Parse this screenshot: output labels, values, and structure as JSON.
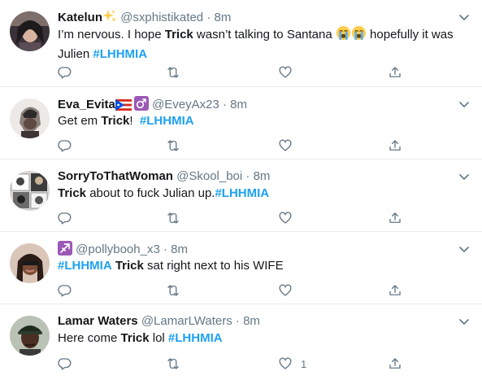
{
  "tweets": [
    {
      "name": "Katelun",
      "handle": "@sxphistikated",
      "separator": "·",
      "time": "8m",
      "name_emoji": "sparkles",
      "segments": [
        {
          "text": "I’m nervous. I hope "
        },
        {
          "text": "Trick",
          "style": "bold"
        },
        {
          "text": " wasn’t talking to Santana "
        },
        {
          "emoji": "crying-face"
        },
        {
          "emoji": "crying-face"
        },
        {
          "text": " hopefully it was Julien "
        },
        {
          "text": "#LHHMIA",
          "style": "hashtag"
        }
      ],
      "reply_count": "",
      "retweet_count": "",
      "like_count": ""
    },
    {
      "name": "Eva_Evita",
      "handle": "@EveyAx23",
      "separator": "·",
      "time": "8m",
      "name_emoji": "flag-puerto-rico-and-male-sign",
      "segments": [
        {
          "text": "Get em "
        },
        {
          "text": "Trick",
          "style": "bold"
        },
        {
          "text": "!  "
        },
        {
          "text": "#LHHMIA",
          "style": "hashtag"
        }
      ],
      "reply_count": "",
      "retweet_count": "",
      "like_count": ""
    },
    {
      "name": "SorryToThatWoman",
      "handle": "@Skool_boi",
      "separator": "·",
      "time": "8m",
      "name_emoji": "",
      "segments": [
        {
          "text": "Trick",
          "style": "bold"
        },
        {
          "text": " about to fuck Julian up."
        },
        {
          "text": "#LHHMIA",
          "style": "hashtag"
        }
      ],
      "reply_count": "",
      "retweet_count": "",
      "like_count": ""
    },
    {
      "name": "",
      "handle": "@pollybooh_x3",
      "separator": "·",
      "time": "8m",
      "name_emoji": "sagittarius",
      "segments": [
        {
          "text": "#LHHMIA",
          "style": "hashtag"
        },
        {
          "text": " "
        },
        {
          "text": "Trick",
          "style": "bold"
        },
        {
          "text": " sat right next to his WIFE"
        }
      ],
      "reply_count": "",
      "retweet_count": "",
      "like_count": ""
    },
    {
      "name": "Lamar Waters",
      "handle": "@LamarLWaters",
      "separator": "·",
      "time": "8m",
      "name_emoji": "",
      "segments": [
        {
          "text": "Here come "
        },
        {
          "text": "Trick",
          "style": "bold"
        },
        {
          "text": " lol "
        },
        {
          "text": "#LHHMIA",
          "style": "hashtag"
        }
      ],
      "reply_count": "",
      "retweet_count": "",
      "like_count": "1"
    }
  ],
  "icons": {
    "reply": "reply-icon",
    "retweet": "retweet-icon",
    "like": "like-icon",
    "share": "share-icon",
    "more": "chevron-down-icon"
  },
  "colors": {
    "hashtag": "#1da1f2",
    "secondary_text": "#657786",
    "divider": "#e6ecf0",
    "text": "#14171a"
  }
}
